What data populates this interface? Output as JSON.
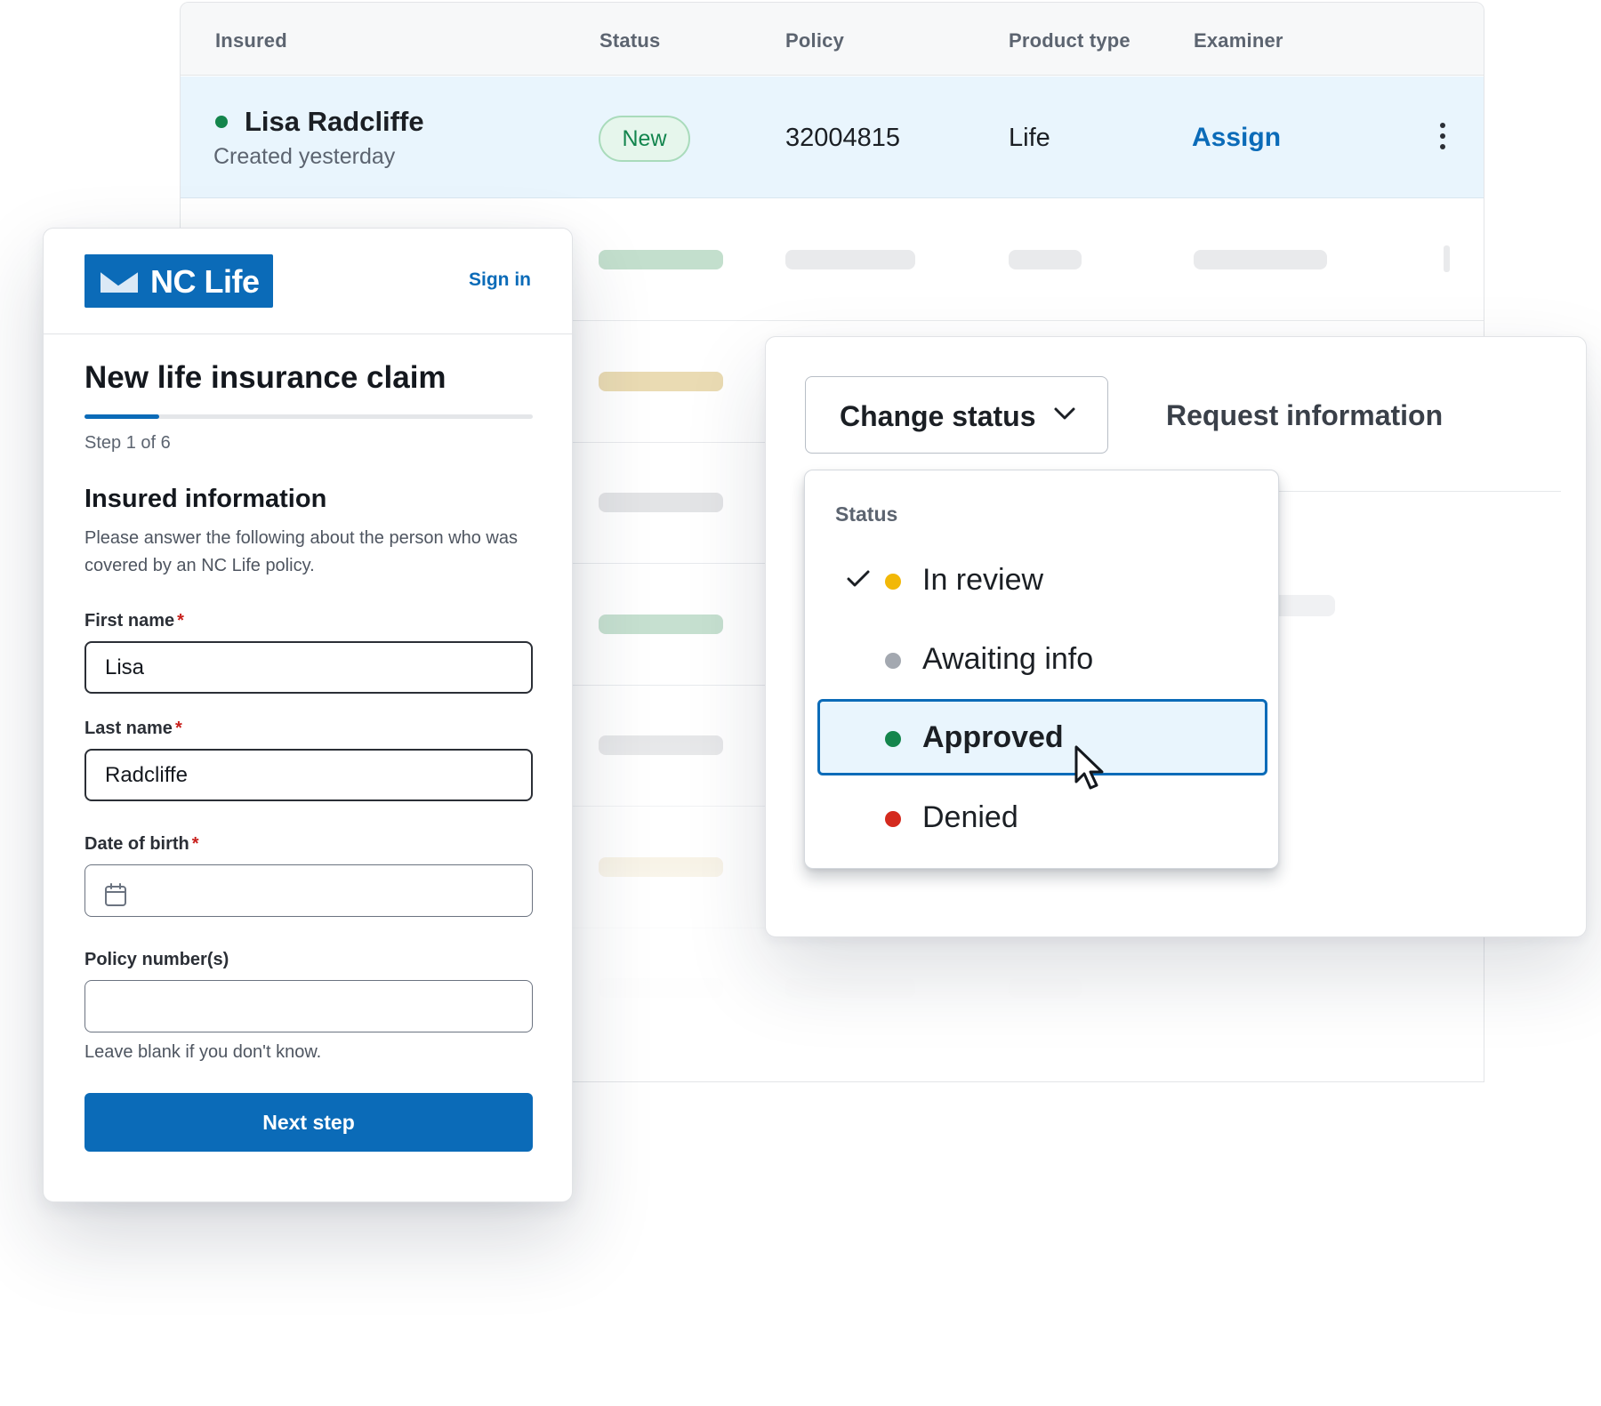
{
  "table": {
    "headers": [
      "Insured",
      "Status",
      "Policy",
      "Product type",
      "Examiner"
    ],
    "active_row": {
      "name": "Lisa Radcliffe",
      "created": "Created yesterday",
      "status": "New",
      "policy": "32004815",
      "product_type": "Life",
      "examiner_action": "Assign"
    }
  },
  "form": {
    "brand": "NC Life",
    "sign_in": "Sign in",
    "title": "New life insurance claim",
    "progress": 0.1667,
    "step": "Step 1 of 6",
    "section_title": "Insured information",
    "section_desc": "Please answer the following about the person who was covered by an NC Life policy.",
    "fields": {
      "first_name": {
        "label": "First name",
        "value": "Lisa"
      },
      "last_name": {
        "label": "Last name",
        "value": "Radcliffe"
      },
      "dob": {
        "label": "Date of birth",
        "value": ""
      },
      "policy_numbers": {
        "label": "Policy number(s)",
        "value": "",
        "helper": "Leave blank if you don't know."
      }
    },
    "required_mark": "*",
    "next_button": "Next step"
  },
  "status_panel": {
    "change_status": "Change status",
    "request_info": "Request information",
    "dropdown_heading": "Status",
    "options": [
      {
        "label": "In review",
        "color": "#f2b807",
        "checked": true
      },
      {
        "label": "Awaiting info",
        "color": "#a3a8b0",
        "checked": false
      },
      {
        "label": "Approved",
        "color": "#14854c",
        "checked": false,
        "hovered": true
      },
      {
        "label": "Denied",
        "color": "#d42a1e",
        "checked": false
      }
    ]
  },
  "colors": {
    "brand_blue": "#0b6bb8",
    "new_badge": "#13854e",
    "active_row_bg": "#e9f5fd",
    "required": "#c8201c"
  },
  "icons": [
    "status-dot-icon",
    "kebab-menu-icon",
    "envelope-logo-icon",
    "calendar-icon",
    "chevron-down-icon",
    "checkmark-icon",
    "mouse-cursor-icon"
  ]
}
